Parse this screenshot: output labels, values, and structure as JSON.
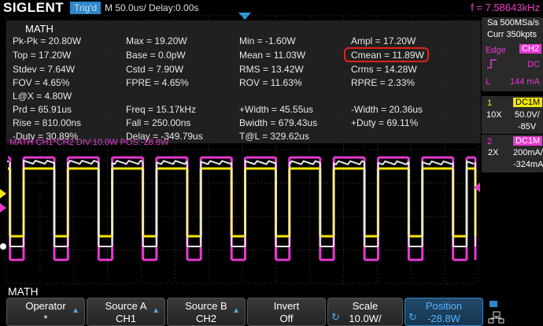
{
  "topbar": {
    "logo": "SIGLENT",
    "trig_status": "Trig'd",
    "timebase": "M 50.0us/  Delay:0.00s",
    "frequency": "f = 7.58643kHz"
  },
  "measurements": {
    "title": "MATH",
    "rows": [
      [
        "Pk-Pk = 20.80W",
        "Max = 19.20W",
        "Min = -1.60W",
        "Ampl = 17.20W"
      ],
      [
        "Top = 17.20W",
        "Base = 0.0pW",
        "Mean = 11.03W",
        "Cmean = 11.89W"
      ],
      [
        "Stdev = 7.64W",
        "Cstd = 7.90W",
        "RMS = 13.42W",
        "Crms = 14.28W"
      ],
      [
        "FOV = 4.65%",
        "FPRE = 4.65%",
        "ROV = 11.63%",
        "RPRE = 2.33%"
      ],
      [
        "L@X = 4.80W",
        "",
        "",
        ""
      ],
      [
        "Prd = 65.91us",
        "Freq = 15.17kHz",
        "+Width = 45.55us",
        "-Width = 20.36us"
      ],
      [
        "Rise = 810.00ns",
        "Fall = 250.00ns",
        "Bwidth = 679.43us",
        "+Duty = 69.11%"
      ],
      [
        "-Duty = 30.89%",
        "Delay = -349.79us",
        "T@L = 329.62us",
        ""
      ]
    ]
  },
  "math_label": "MATH  CH1*CH2  DIV:10.0W  POS:-28.8W",
  "right_panel": {
    "sa": "Sa 500MSa/s",
    "curr": "Curr 350kpts",
    "trig_type": "Edge",
    "trig_source": "CH2",
    "slope_icon": "rising-edge-icon",
    "coupling": "DC",
    "level_label": "L",
    "level_value": "144 mA",
    "ch1": {
      "num": "1",
      "coupling": "DC1M",
      "probe": "10X",
      "scale": "50.0V/",
      "offset": "-85V"
    },
    "ch2": {
      "num": "2",
      "coupling": "DC1M",
      "probe": "2X",
      "scale": "200mA/",
      "offset": "-324mA"
    }
  },
  "menu": {
    "title": "MATH",
    "buttons": [
      {
        "l1": "Operator",
        "l2": "*"
      },
      {
        "l1": "Source A",
        "l2": "CH1"
      },
      {
        "l1": "Source B",
        "l2": "CH2"
      },
      {
        "l1": "Invert",
        "l2": "Off"
      },
      {
        "l1": "Scale",
        "l2": "10.0W/"
      },
      {
        "l1": "Position",
        "l2": "-28.8W"
      }
    ]
  },
  "colors": {
    "ch1": "#f5e600",
    "ch2": "#e53ad0",
    "math": "#e8e8e8",
    "accent": "#2f86c8",
    "highlight": "#e2231a"
  }
}
